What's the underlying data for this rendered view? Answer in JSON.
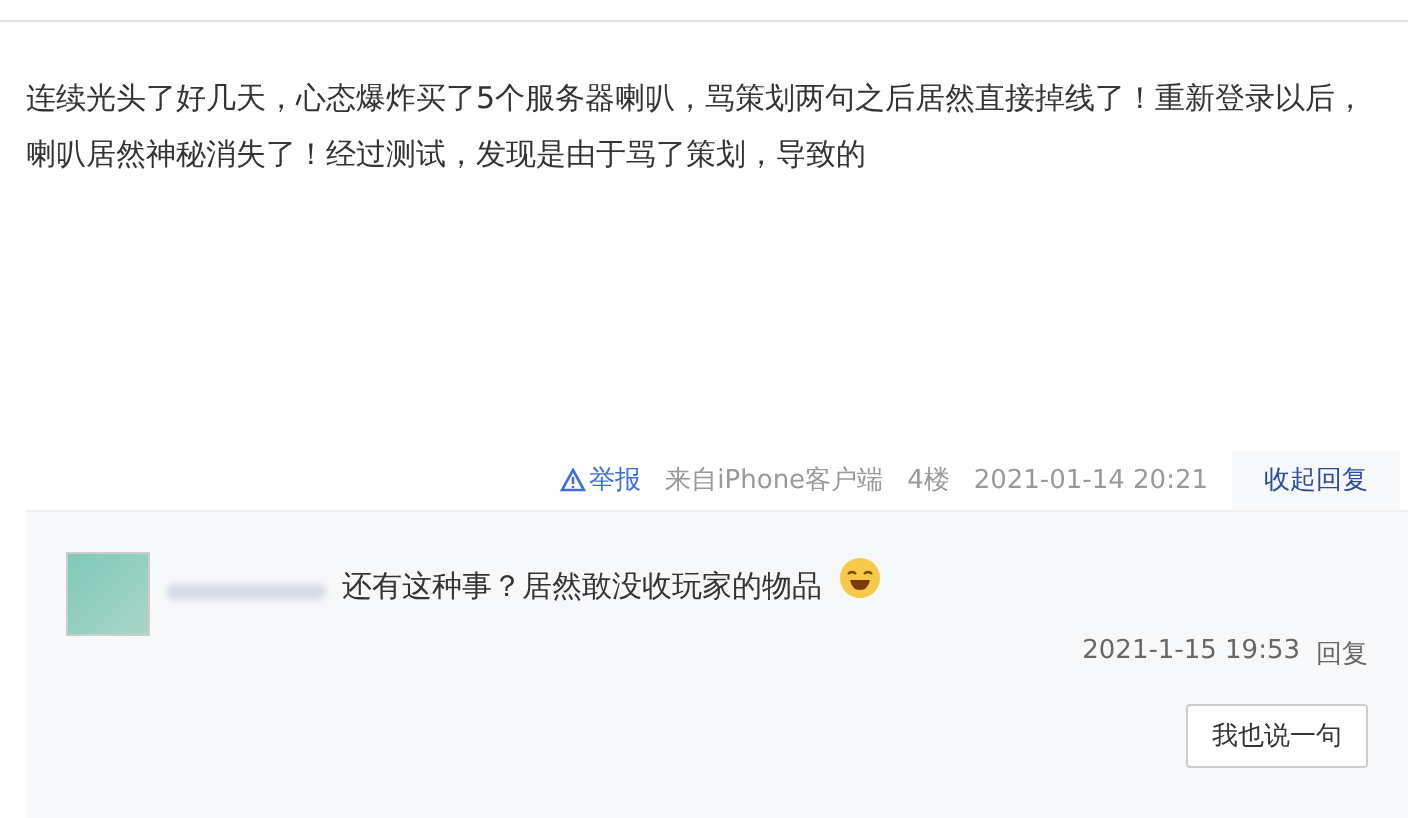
{
  "post": {
    "text": "连续光头了好几天，心态爆炸买了5个服务器喇叭，骂策划两句之后居然直接掉线了！重新登录以后，喇叭居然神秘消失了！经过测试，发现是由于骂了策划，导致的"
  },
  "meta": {
    "report": "举报",
    "source": "来自iPhone客户端",
    "floor": "4楼",
    "time": "2021-01-14 20:21",
    "toggle": "收起回复",
    "expanded": true
  },
  "replies": [
    {
      "text": "还有这种事？居然敢没收玩家的物品",
      "time": "2021-1-15 19:53",
      "reply": "回复"
    }
  ],
  "compose_button": "我也说一句"
}
